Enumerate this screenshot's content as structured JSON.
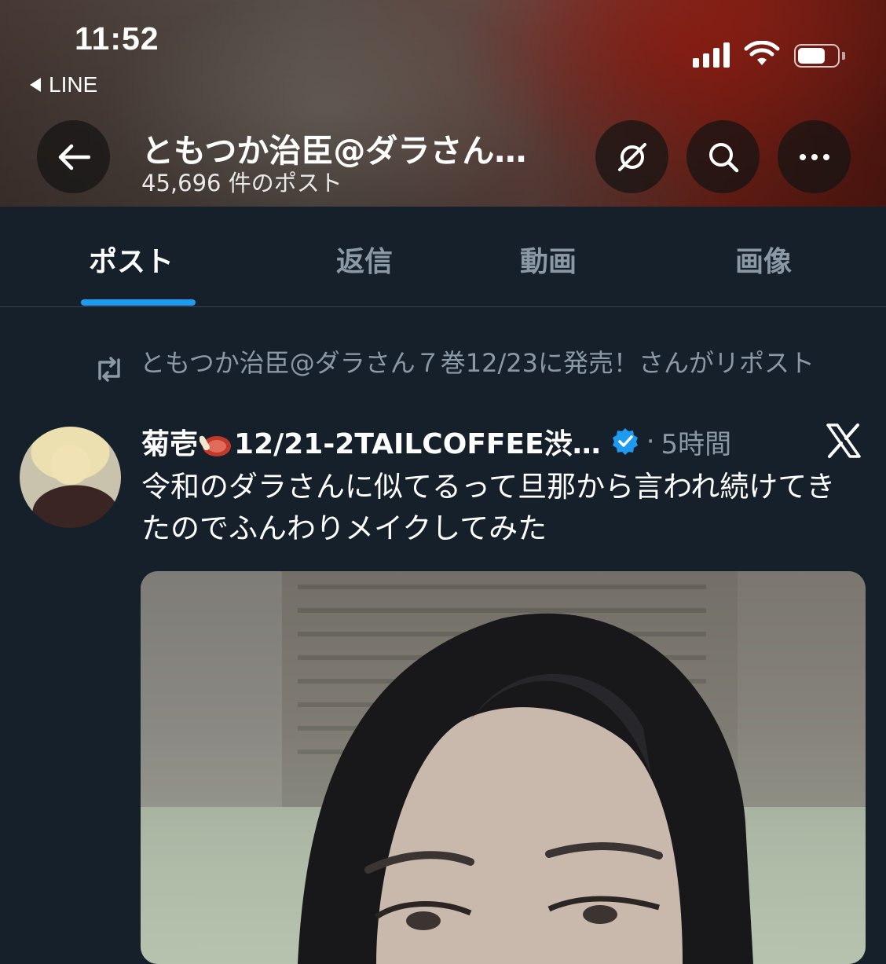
{
  "status_bar": {
    "time": "11:52",
    "back_app": "LINE"
  },
  "profile_header": {
    "name": "ともつか治臣@ダラさん…",
    "post_count": "45,696 件のポスト"
  },
  "header_icons": {
    "back": "arrow-left-icon",
    "grok": "grok-icon",
    "search": "search-icon",
    "more": "more-icon"
  },
  "tabs": [
    {
      "label": "ポスト",
      "active": true
    },
    {
      "label": "返信",
      "active": false
    },
    {
      "label": "動画",
      "active": false
    },
    {
      "label": "画像",
      "active": false
    }
  ],
  "tweet": {
    "repost_text": "ともつか治臣@ダラさん７巻12/23に発売！さんがリポスト",
    "author_name_prefix": "菊壱",
    "author_name_suffix": "12/21-2TAILCOFFEE渋…",
    "verified": true,
    "time_sep": "·",
    "time": "5時間",
    "text": "令和のダラさんに似てるって旦那から言われ続けてきたのでふんわりメイクしてみた"
  },
  "colors": {
    "background": "#15202b",
    "accent": "#1d9bf0",
    "muted_text": "#8b98a5",
    "divider": "#38444d"
  }
}
